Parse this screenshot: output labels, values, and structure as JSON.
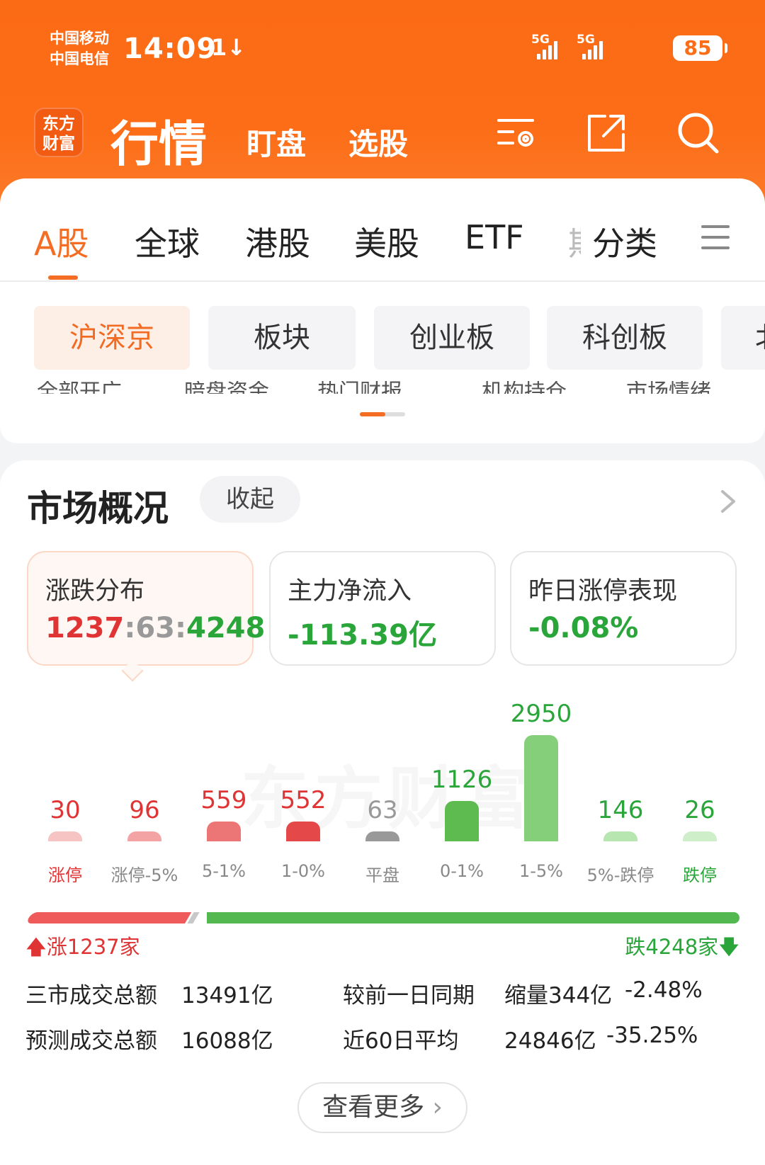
{
  "status_bar": {
    "carrier1": "中国移动",
    "carrier2": "中国电信",
    "time": "14:09",
    "net_indicator": "1↓",
    "signal1": "5G",
    "signal2": "5G",
    "battery": "85"
  },
  "app_bar": {
    "logo_line1": "东方",
    "logo_line2": "财富",
    "title": "行情",
    "nav1": "盯盘",
    "nav2": "选股",
    "icons": [
      "settings-list-icon",
      "share-icon",
      "search-icon"
    ]
  },
  "market_tabs": [
    "A股",
    "全球",
    "港股",
    "美股",
    "ETF",
    "期",
    "分类"
  ],
  "sub_tabs": [
    "沪深京",
    "板块",
    "创业板",
    "科创板",
    "北"
  ],
  "cut_row": [
    "全部开广",
    "暗盘资金",
    "热门财报",
    "机构持仓",
    "市场情绪"
  ],
  "overview": {
    "title": "市场概况",
    "collapse_label": "收起",
    "cards": [
      {
        "label": "涨跌分布",
        "up": "1237",
        "sep1": ":",
        "flat": "63",
        "sep2": ":",
        "down": "4248"
      },
      {
        "label": "主力净流入",
        "value": "-113.39亿"
      },
      {
        "label": "昨日涨停表现",
        "value": "-0.08%"
      }
    ],
    "watermark": "东方财富",
    "rise_label": "涨1237家",
    "fall_label": "跌4248家",
    "stats": {
      "turnover_label": "三市成交总额",
      "turnover_value": "13491亿",
      "compare_label": "较前一日同期",
      "compare_value": "缩量344亿",
      "compare_pct": "-2.48%",
      "forecast_label": "预测成交总额",
      "forecast_value": "16088亿",
      "avg60_label": "近60日平均",
      "avg60_value": "24846亿",
      "avg60_pct": "-35.25%"
    },
    "more_label": "查看更多"
  },
  "chart_data": {
    "type": "bar",
    "categories": [
      "涨停",
      "涨停-5%",
      "5-1%",
      "1-0%",
      "平盘",
      "0-1%",
      "1-5%",
      "5%-跌停",
      "跌停"
    ],
    "values": [
      30,
      96,
      559,
      552,
      63,
      1126,
      2950,
      146,
      26
    ],
    "colors": [
      "#f7c4c4",
      "#f3a3a3",
      "#ec7676",
      "#e54848",
      "#999999",
      "#5dbb4f",
      "#85cf7a",
      "#b8e6b0",
      "#cdeec8"
    ],
    "ratio": {
      "up": 1237,
      "flat": 63,
      "down": 4248
    },
    "ratio_colors": {
      "up": "#ef5a5a",
      "flat": "#c8c8c8",
      "down": "#52b84f"
    }
  }
}
